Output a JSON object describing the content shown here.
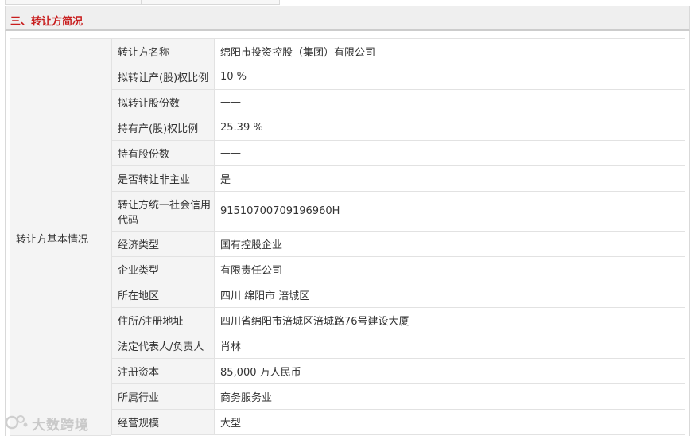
{
  "section": {
    "title": "三、转让方简况"
  },
  "group": {
    "label": "转让方基本情况"
  },
  "rows": [
    {
      "label": "转让方名称",
      "value": "绵阳市投资控股（集团）有限公司"
    },
    {
      "label": "拟转让产(股)权比例",
      "value": "10 %"
    },
    {
      "label": "拟转让股份数",
      "value": "——"
    },
    {
      "label": "持有产(股)权比例",
      "value": "25.39 %"
    },
    {
      "label": "持有股份数",
      "value": "——"
    },
    {
      "label": "是否转让非主业",
      "value": "是"
    },
    {
      "label": "转让方统一社会信用代码",
      "value": "91510700709196960H"
    },
    {
      "label": "经济类型",
      "value": "国有控股企业"
    },
    {
      "label": "企业类型",
      "value": "有限责任公司"
    },
    {
      "label": "所在地区",
      "value": "四川 绵阳市 涪城区"
    },
    {
      "label": "住所/注册地址",
      "value": "四川省绵阳市涪城区涪城路76号建设大厦"
    },
    {
      "label": "法定代表人/负责人",
      "value": "肖林"
    },
    {
      "label": "注册资本",
      "value": "85,000 万人民币"
    },
    {
      "label": "所属行业",
      "value": "商务服务业"
    },
    {
      "label": "经营规模",
      "value": "大型"
    }
  ],
  "watermark": {
    "text": "大数跨境"
  }
}
